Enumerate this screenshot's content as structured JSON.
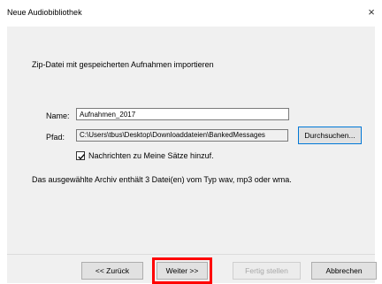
{
  "window": {
    "title": "Neue Audiobibliothek",
    "close_glyph": "×"
  },
  "page": {
    "heading": "Zip-Datei mit gespeicherten Aufnahmen importieren",
    "name_label": "Name:",
    "name_value": "Aufnahmen_2017",
    "path_label": "Pfad:",
    "path_value": "C:\\Users\\tbus\\Desktop\\Downloaddateien\\BankedMessages",
    "browse_label": "Durchsuchen...",
    "checkbox_label": "Nachrichten zu Meine Sätze hinzuf.",
    "checkbox_checked": true,
    "info": "Das ausgewählte Archiv enthält 3 Datei(en) vom Typ wav, mp3 oder wma."
  },
  "buttons": {
    "back": "<< Zurück",
    "next": "Weiter >>",
    "finish": "Fertig stellen",
    "cancel": "Abbrechen"
  },
  "colors": {
    "highlight": "#ff0000",
    "focus": "#0078d7"
  }
}
